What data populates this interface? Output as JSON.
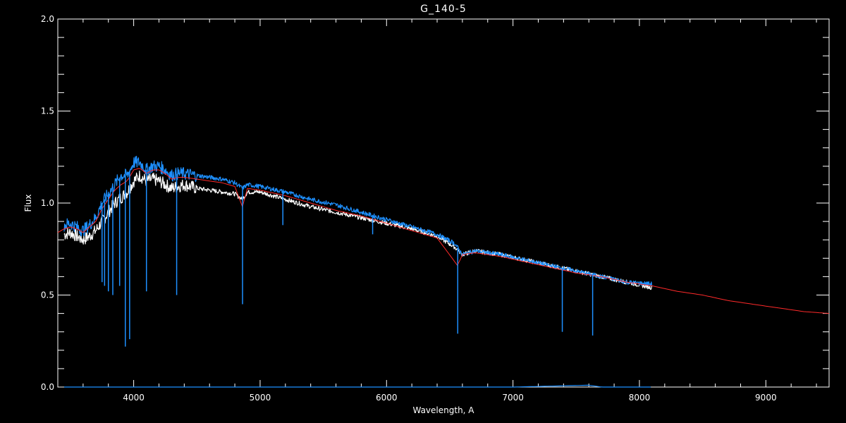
{
  "chart_data": {
    "type": "line",
    "title": "G_140-5",
    "xlabel": "Wavelength, A",
    "ylabel": "Flux",
    "xlim": [
      3400,
      9500
    ],
    "ylim": [
      0.0,
      2.0
    ],
    "x_ticks": [
      4000,
      5000,
      6000,
      7000,
      8000,
      9000
    ],
    "x_tick_labels": [
      "4000",
      "5000",
      "6000",
      "7000",
      "8000",
      "9000"
    ],
    "y_ticks": [
      0.0,
      0.5,
      1.0,
      1.5,
      2.0
    ],
    "y_tick_labels": [
      "0.0",
      "0.5",
      "1.0",
      "1.5",
      "2.0"
    ],
    "x_minor_step": 200,
    "y_minor_step": 0.1,
    "grid": false,
    "background": "#000000",
    "axis_color": "#ffffff",
    "series": [
      {
        "color": "#ffffff",
        "x": [
          3450,
          3500,
          3550,
          3600,
          3650,
          3700,
          3750,
          3800,
          3850,
          3900,
          3950,
          4000,
          4050,
          4100,
          4150,
          4200,
          4250,
          4300,
          4350,
          4400,
          4500,
          4600,
          4700,
          4800,
          4860,
          4900,
          5000,
          5200,
          5400,
          5600,
          5800,
          6000,
          6200,
          6400,
          6540,
          6600,
          6700,
          6900,
          7100,
          7300,
          7500,
          7700,
          7900,
          8100
        ],
        "y": [
          0.83,
          0.84,
          0.82,
          0.8,
          0.82,
          0.85,
          0.9,
          0.95,
          1.0,
          1.03,
          1.06,
          1.12,
          1.15,
          1.12,
          1.13,
          1.12,
          1.1,
          1.08,
          1.09,
          1.1,
          1.08,
          1.07,
          1.06,
          1.05,
          1.02,
          1.06,
          1.06,
          1.02,
          0.98,
          0.95,
          0.92,
          0.89,
          0.86,
          0.82,
          0.76,
          0.72,
          0.74,
          0.72,
          0.69,
          0.66,
          0.63,
          0.6,
          0.57,
          0.54
        ]
      },
      {
        "color": "#1e90ff",
        "x": [
          3450,
          3500,
          3550,
          3600,
          3650,
          3700,
          3750,
          3800,
          3850,
          3900,
          3950,
          4000,
          4050,
          4100,
          4150,
          4200,
          4250,
          4300,
          4350,
          4400,
          4500,
          4600,
          4700,
          4800,
          4860,
          4900,
          5000,
          5200,
          5400,
          5600,
          5800,
          6000,
          6200,
          6400,
          6540,
          6600,
          6700,
          6900,
          7100,
          7300,
          7500,
          7700,
          7900,
          8100
        ],
        "y": [
          0.88,
          0.89,
          0.87,
          0.85,
          0.88,
          0.92,
          1.0,
          1.05,
          1.1,
          1.15,
          1.15,
          1.22,
          1.22,
          1.18,
          1.2,
          1.2,
          1.18,
          1.15,
          1.16,
          1.16,
          1.15,
          1.14,
          1.13,
          1.11,
          1.08,
          1.1,
          1.09,
          1.06,
          1.02,
          0.99,
          0.95,
          0.91,
          0.87,
          0.83,
          0.78,
          0.72,
          0.74,
          0.72,
          0.69,
          0.66,
          0.63,
          0.6,
          0.57,
          0.56
        ]
      },
      {
        "color": "#ff2a2a",
        "x": [
          3400,
          3450,
          3500,
          3550,
          3600,
          3650,
          3700,
          3750,
          3800,
          3850,
          3900,
          3950,
          4000,
          4050,
          4100,
          4150,
          4200,
          4250,
          4300,
          4350,
          4400,
          4500,
          4600,
          4700,
          4800,
          4860,
          4900,
          5000,
          5200,
          5400,
          5600,
          5800,
          6000,
          6200,
          6400,
          6562,
          6600,
          6700,
          6900,
          7100,
          7300,
          7500,
          7700,
          7900,
          8100,
          8300,
          8500,
          8700,
          8900,
          9100,
          9300,
          9500
        ],
        "y": [
          0.84,
          0.86,
          0.87,
          0.86,
          0.84,
          0.87,
          0.9,
          0.97,
          1.02,
          1.07,
          1.1,
          1.12,
          1.18,
          1.19,
          1.16,
          1.18,
          1.18,
          1.16,
          1.13,
          1.14,
          1.14,
          1.13,
          1.12,
          1.11,
          1.09,
          0.98,
          1.08,
          1.07,
          1.04,
          1.0,
          0.96,
          0.93,
          0.89,
          0.85,
          0.81,
          0.66,
          0.72,
          0.73,
          0.71,
          0.68,
          0.65,
          0.62,
          0.6,
          0.57,
          0.55,
          0.52,
          0.5,
          0.47,
          0.45,
          0.43,
          0.41,
          0.4
        ]
      },
      {
        "color": "#1e90ff",
        "x": [
          3450,
          5000,
          6000,
          7000,
          7600,
          7700,
          8100
        ],
        "y": [
          0.0,
          0.0,
          0.0,
          0.0,
          0.01,
          0.0,
          0.0
        ]
      }
    ],
    "absorption_lines": [
      {
        "x": 3750,
        "y_min": 0.57,
        "color": "#1e90ff"
      },
      {
        "x": 3770,
        "y_min": 0.55,
        "color": "#1e90ff"
      },
      {
        "x": 3800,
        "y_min": 0.52,
        "color": "#1e90ff"
      },
      {
        "x": 3835,
        "y_min": 0.5,
        "color": "#1e90ff"
      },
      {
        "x": 3889,
        "y_min": 0.55,
        "color": "#1e90ff"
      },
      {
        "x": 3934,
        "y_min": 0.22,
        "color": "#1e90ff"
      },
      {
        "x": 3968,
        "y_min": 0.26,
        "color": "#1e90ff"
      },
      {
        "x": 4101,
        "y_min": 0.52,
        "color": "#1e90ff"
      },
      {
        "x": 4340,
        "y_min": 0.5,
        "color": "#1e90ff"
      },
      {
        "x": 4861,
        "y_min": 0.45,
        "color": "#1e90ff"
      },
      {
        "x": 5180,
        "y_min": 0.88,
        "color": "#1e90ff"
      },
      {
        "x": 5890,
        "y_min": 0.83,
        "color": "#1e90ff"
      },
      {
        "x": 6563,
        "y_min": 0.29,
        "color": "#1e90ff"
      },
      {
        "x": 7390,
        "y_min": 0.3,
        "color": "#1e90ff"
      },
      {
        "x": 7630,
        "y_min": 0.28,
        "color": "#1e90ff"
      }
    ]
  }
}
